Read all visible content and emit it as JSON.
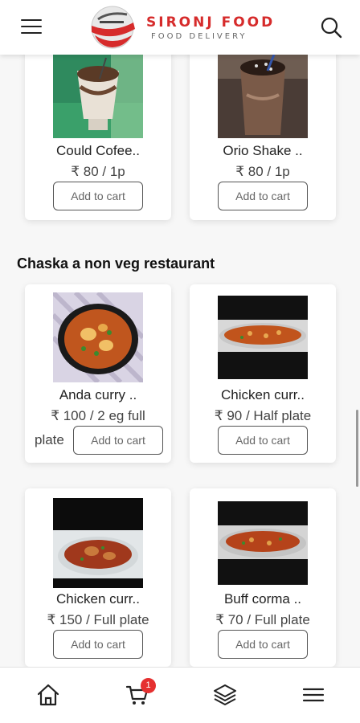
{
  "header": {
    "logo_title": "SIRONJ FOOD",
    "logo_subtitle": "FOOD DELIVERY",
    "accent_color": "#d62b2b",
    "menu_icon": "hamburger-icon",
    "search_icon": "search-icon"
  },
  "currency": "₹",
  "items_top": [
    {
      "name": "Could Cofee..",
      "price": "₹ 80 / 1p",
      "button": "Add to cart"
    },
    {
      "name": "Orio Shake ..",
      "price": "₹ 80 / 1p",
      "button": "Add to cart"
    }
  ],
  "section": {
    "title": "Chaska a non veg restaurant"
  },
  "items_section": [
    {
      "name": "Anda curry ..",
      "price_line1": "₹ 100 / 2 eg full",
      "price_line2": "plate",
      "button": "Add to cart"
    },
    {
      "name": "Chicken curr..",
      "price": "₹ 90 / Half plate",
      "button": "Add to cart"
    },
    {
      "name": "Chicken curr..",
      "price": "₹ 150 / Full plate",
      "button": "Add to cart"
    },
    {
      "name": "Buff corma ..",
      "price": "₹ 70 / Full plate",
      "button": "Add to cart"
    }
  ],
  "bottom_nav": {
    "items": [
      {
        "icon": "home-icon"
      },
      {
        "icon": "cart-icon"
      },
      {
        "icon": "layers-icon"
      },
      {
        "icon": "menu-icon"
      }
    ],
    "cart_badge": "1",
    "badge_color": "#e53030"
  }
}
